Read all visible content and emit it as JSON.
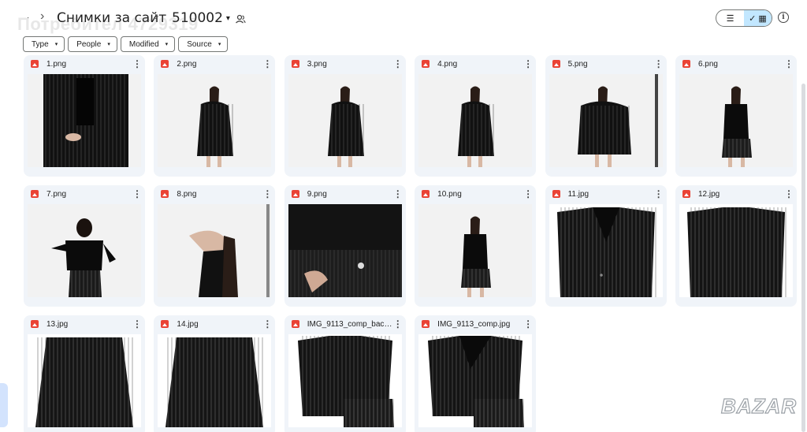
{
  "header": {
    "back_arrow": "·",
    "crumb_parent": "Снимки за сайт",
    "crumb_separator": "›",
    "crumb_current": "510002",
    "crumb_caret": "▾",
    "watermark": "Потребител 4729319"
  },
  "view": {
    "list_icon": "☰",
    "grid_icon": "✓ ▦",
    "info_icon": "i"
  },
  "filters": [
    {
      "label": "Type",
      "caret": "▾"
    },
    {
      "label": "People",
      "caret": "▾"
    },
    {
      "label": "Modified",
      "caret": "▾"
    },
    {
      "label": "Source",
      "caret": "▾"
    }
  ],
  "files": [
    {
      "name": "1.png",
      "kind": "model-front-blazer"
    },
    {
      "name": "2.png",
      "kind": "model-side"
    },
    {
      "name": "3.png",
      "kind": "model-side"
    },
    {
      "name": "4.png",
      "kind": "model-back"
    },
    {
      "name": "5.png",
      "kind": "model-cape"
    },
    {
      "name": "6.png",
      "kind": "model-top"
    },
    {
      "name": "7.png",
      "kind": "model-back-top"
    },
    {
      "name": "8.png",
      "kind": "model-lean"
    },
    {
      "name": "9.png",
      "kind": "closeup"
    },
    {
      "name": "10.png",
      "kind": "model-top"
    },
    {
      "name": "11.jpg",
      "kind": "blazer"
    },
    {
      "name": "12.jpg",
      "kind": "blazer-back"
    },
    {
      "name": "13.jpg",
      "kind": "skirt"
    },
    {
      "name": "14.jpg",
      "kind": "skirt"
    },
    {
      "name": "IMG_9113_comp_back....",
      "kind": "set-back"
    },
    {
      "name": "IMG_9113_comp.jpg",
      "kind": "set-front"
    }
  ],
  "more_icon": "⋮",
  "brand_watermark": "BAZAR"
}
